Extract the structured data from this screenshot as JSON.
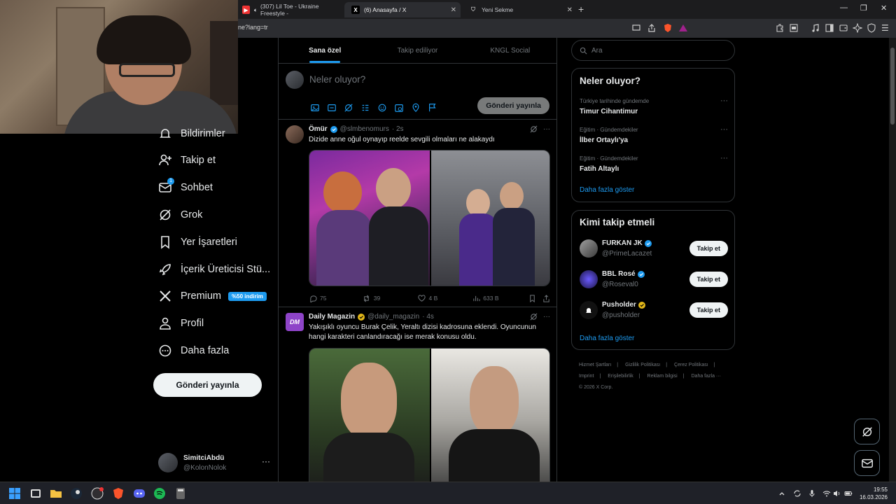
{
  "browser": {
    "tabs": [
      {
        "title": "(307) Lil Toe - Ukraine Freestyle -",
        "active": false
      },
      {
        "title": "(6) Anasayfa / X",
        "active": true
      },
      {
        "title": "Yeni Sekme",
        "active": false
      }
    ],
    "url": "ne?lang=tr"
  },
  "sidebar": {
    "items": [
      {
        "label": "Bildirimler",
        "icon": "bell-icon"
      },
      {
        "label": "Takip et",
        "icon": "follow-icon"
      },
      {
        "label": "Sohbet",
        "icon": "mail-icon",
        "badge": "1"
      },
      {
        "label": "Grok",
        "icon": "grok-icon"
      },
      {
        "label": "Yer İşaretleri",
        "icon": "bookmark-icon"
      },
      {
        "label": "İçerik Üreticisi Stü...",
        "icon": "rocket-icon"
      },
      {
        "label": "Premium",
        "icon": "x-logo-icon",
        "badge": "%50 indirim"
      },
      {
        "label": "Profil",
        "icon": "person-icon"
      },
      {
        "label": "Daha fazla",
        "icon": "more-circle-icon"
      }
    ],
    "post_button": "Gönderi yayınla",
    "account": {
      "name": "SimitciAbdü",
      "handle": "@KolonNolok"
    }
  },
  "feed": {
    "tabs": [
      "Sana özel",
      "Takip ediliyor",
      "KNGL Social"
    ],
    "composer": {
      "placeholder": "Neler oluyor?",
      "button": "Gönderi yayınla"
    },
    "posts": [
      {
        "name": "Ömür",
        "handle": "@slmbenomurs",
        "time": "· 2s",
        "text": "Dizide anne oğul oynayıp reelde sevgili olmaları ne alakaydı",
        "replies": "75",
        "reposts": "39",
        "likes": "4 B",
        "views": "633 B"
      },
      {
        "name": "Daily Magazin",
        "handle": "@daily_magazin",
        "time": "· 4s",
        "text": "Yakışıklı oyuncu Burak Çelik, Yeraltı dizisi kadrosuna eklendi. Oyuncunun hangi karakteri canlandıracağı ise merak konusu oldu.",
        "avatar_text": "DM"
      }
    ]
  },
  "right": {
    "search_placeholder": "Ara",
    "trends_title": "Neler oluyor?",
    "trends": [
      {
        "context": "Türkiye tarihinde gündemde",
        "title": "Timur Cihantimur"
      },
      {
        "context": "Eğitim · Gündemdekiler",
        "title": "İlber Ortaylı'ya"
      },
      {
        "context": "Eğitim · Gündemdekiler",
        "title": "Fatih Altaylı"
      }
    ],
    "show_more": "Daha fazla göster",
    "who_title": "Kimi takip etmeli",
    "who": [
      {
        "name": "FURKAN JK",
        "handle": "@PrimeLacazet",
        "verified": "blue"
      },
      {
        "name": "BBL Rosé",
        "handle": "@Roseval0",
        "verified": "blue"
      },
      {
        "name": "Pusholder",
        "handle": "@pusholder",
        "verified": "gold"
      }
    ],
    "follow_label": "Takip et",
    "footer": [
      "Hizmet Şartları",
      "|",
      "Gizlilik Politikası",
      "|",
      "Çerez Politikası",
      "|",
      "Imprint",
      "|",
      "Erişilebilirlik",
      "|",
      "Reklam bilgisi",
      "|",
      "Daha fazla ···",
      "© 2026 X Corp."
    ]
  },
  "taskbar": {
    "time": "19:55",
    "date": "16.03.2026"
  },
  "colors": {
    "accent": "#1d9bf0",
    "background": "#000000",
    "border": "#2f3336",
    "muted": "#71767b",
    "gold": "#e2b719"
  }
}
